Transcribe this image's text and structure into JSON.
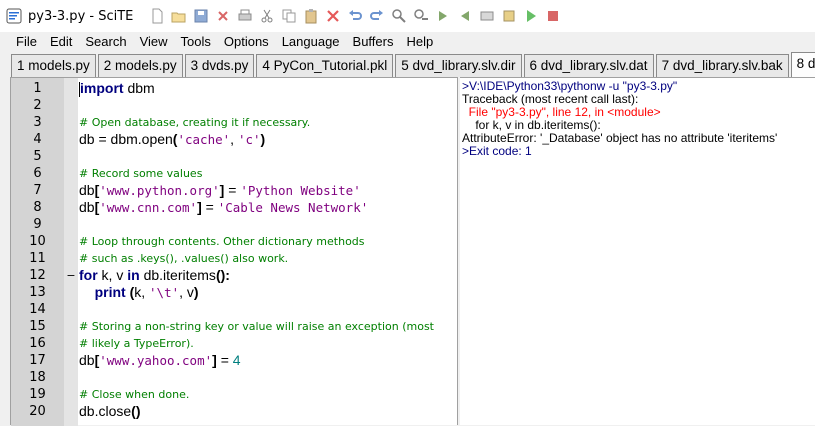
{
  "window": {
    "title": "py3-3.py - SciTE"
  },
  "menu": [
    "File",
    "Edit",
    "Search",
    "View",
    "Tools",
    "Options",
    "Language",
    "Buffers",
    "Help"
  ],
  "tabs": [
    "1 models.py",
    "2 models.py",
    "3 dvds.py",
    "4 PyCon_Tutorial.pkl",
    "5 dvd_library.slv.dir",
    "6 dvd_library.slv.dat",
    "7 dvd_library.slv.bak",
    "8 dvd_"
  ],
  "active_tab": 7,
  "editor": {
    "lines": [
      {
        "n": "1",
        "text": "import dbm"
      },
      {
        "n": "2",
        "text": ""
      },
      {
        "n": "3",
        "text": "# Open database, creating it if necessary."
      },
      {
        "n": "4",
        "text": "db = dbm.open('cache', 'c')"
      },
      {
        "n": "5",
        "text": ""
      },
      {
        "n": "6",
        "text": "# Record some values"
      },
      {
        "n": "7",
        "text": "db['www.python.org'] = 'Python Website'"
      },
      {
        "n": "8",
        "text": "db['www.cnn.com'] = 'Cable News Network'"
      },
      {
        "n": "9",
        "text": ""
      },
      {
        "n": "10",
        "text": "# Loop through contents. Other dictionary methods"
      },
      {
        "n": "11",
        "text": "# such as .keys(), .values() also work."
      },
      {
        "n": "12",
        "text": "for k, v in db.iteritems():"
      },
      {
        "n": "13",
        "text": "    print (k, '\\t', v)"
      },
      {
        "n": "14",
        "text": ""
      },
      {
        "n": "15",
        "text": "# Storing a non-string key or value will raise an exception (most"
      },
      {
        "n": "16",
        "text": "# likely a TypeError)."
      },
      {
        "n": "17",
        "text": "db['www.yahoo.com'] = 4"
      },
      {
        "n": "18",
        "text": ""
      },
      {
        "n": "19",
        "text": "# Close when done."
      },
      {
        "n": "20",
        "text": "db.close()"
      }
    ],
    "fold_marker": "−"
  },
  "output": {
    "lines": [
      {
        "kind": "cmd",
        "text": ">V:\\IDE\\Python33\\pythonw -u \"py3-3.py\""
      },
      {
        "kind": "plain",
        "text": "Traceback (most recent call last):"
      },
      {
        "kind": "err",
        "text": "  File \"py3-3.py\", line 12, in <module>"
      },
      {
        "kind": "plain",
        "text": "    for k, v in db.iteritems():"
      },
      {
        "kind": "plain",
        "text": "AttributeError: '_Database' object has no attribute 'iteritems'"
      },
      {
        "kind": "cmd",
        "text": ">Exit code: 1"
      }
    ]
  },
  "colors": {
    "keyword": "#00007f",
    "comment": "#007f00",
    "string": "#7f007f",
    "number": "#007f7f",
    "error": "#ff0000"
  }
}
